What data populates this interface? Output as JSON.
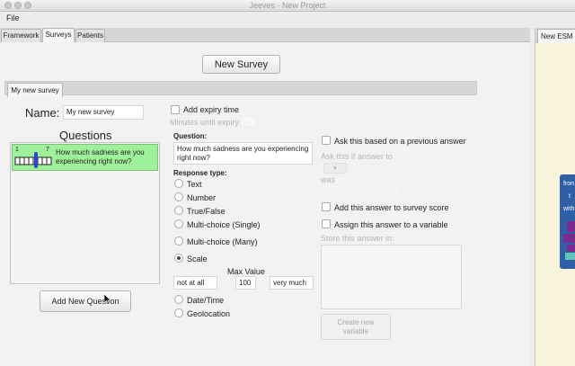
{
  "window": {
    "title": "Jeeves - New Project"
  },
  "menu": {
    "file": "File"
  },
  "tabs": [
    {
      "label": "Framework"
    },
    {
      "label": "Surveys"
    },
    {
      "label": "Patients"
    }
  ],
  "right_panel": {
    "tab_label": "New ESM S",
    "card_lines": [
      "fron",
      "t",
      "with"
    ]
  },
  "toolbar": {
    "new_survey": "New Survey"
  },
  "survey_tab": {
    "label": "My new survey"
  },
  "name": {
    "label": "Name:",
    "value": "My new survey"
  },
  "questions": {
    "heading": "Questions",
    "items": [
      {
        "scale_min": "1",
        "scale_max": "7",
        "text": "How much sadness are you experiencing right now?"
      }
    ],
    "add_button": "Add New Question"
  },
  "expiry": {
    "label": "Add expiry time",
    "minutes_label": "Minutes until expiry:"
  },
  "question": {
    "label": "Question:",
    "value": "How much sadness are you experiencing right now?"
  },
  "response": {
    "label": "Response type:",
    "options": [
      "Text",
      "Number",
      "True/False",
      "Multi-choice (Single)",
      "Multi-choice (Many)",
      "Scale",
      "Date/Time",
      "Geolocation"
    ],
    "selected": "Scale"
  },
  "scale": {
    "max_label": "Max Value",
    "min_text": "not at all",
    "max_value": "100",
    "max_text": "very much"
  },
  "conditions": {
    "based_on_previous": "Ask this based on a previous answer",
    "ask_if": "Ask this if answer to",
    "was": "was",
    "add_to_score": "Add this answer to survey score",
    "assign_variable": "Assign this answer to a variable",
    "store_in": "Store this answer in:",
    "create_variable": "Create new variable"
  }
}
